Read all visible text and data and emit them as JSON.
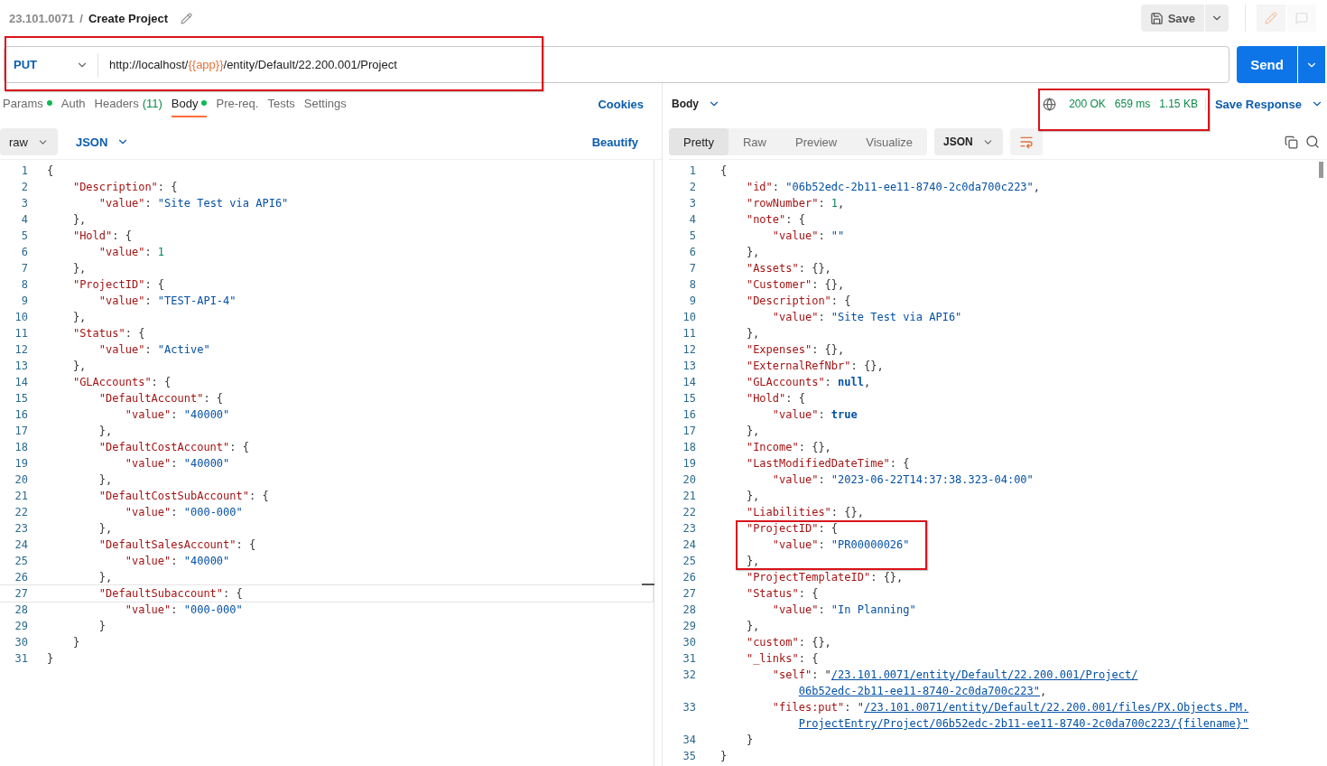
{
  "breadcrumb": {
    "collection": "23.101.0071",
    "separator": "/",
    "title": "Create Project"
  },
  "header_actions": {
    "save": "Save"
  },
  "request": {
    "method": "PUT",
    "url_parts": [
      {
        "kind": "plain",
        "text": "http://localhost/"
      },
      {
        "kind": "variable",
        "text": "{{app}}"
      },
      {
        "kind": "plain",
        "text": "/entity/Default/22.200.001/Project"
      }
    ],
    "send": "Send"
  },
  "request_tabs": [
    {
      "label": "Params",
      "indicator": true,
      "selected": false
    },
    {
      "label": "Auth",
      "indicator": false,
      "selected": false
    },
    {
      "label": "Headers",
      "count": "(11)",
      "indicator": false,
      "selected": false
    },
    {
      "label": "Body",
      "indicator": true,
      "selected": true
    },
    {
      "label": "Pre-req.",
      "indicator": false,
      "selected": false
    },
    {
      "label": "Tests",
      "indicator": false,
      "selected": false
    },
    {
      "label": "Settings",
      "indicator": false,
      "selected": false
    }
  ],
  "cookies": "Cookies",
  "body_options": {
    "mode": "raw",
    "language": "JSON",
    "beautify": "Beautify"
  },
  "request_body": [
    {
      "number": "1",
      "text": "{",
      "active": false
    },
    {
      "number": "2",
      "text": "    \"Description\": {",
      "active": false
    },
    {
      "number": "3",
      "text": "        \"value\": \"Site Test via API6\"",
      "active": false
    },
    {
      "number": "4",
      "text": "    },",
      "active": false
    },
    {
      "number": "5",
      "text": "    \"Hold\": {",
      "active": false
    },
    {
      "number": "6",
      "text": "        \"value\": 1",
      "active": false
    },
    {
      "number": "7",
      "text": "    },",
      "active": false
    },
    {
      "number": "8",
      "text": "    \"ProjectID\": {",
      "active": false
    },
    {
      "number": "9",
      "text": "        \"value\": \"TEST-API-4\"",
      "active": false
    },
    {
      "number": "10",
      "text": "    },",
      "active": false
    },
    {
      "number": "11",
      "text": "    \"Status\": {",
      "active": false
    },
    {
      "number": "12",
      "text": "        \"value\": \"Active\"",
      "active": false
    },
    {
      "number": "13",
      "text": "    },",
      "active": false
    },
    {
      "number": "14",
      "text": "    \"GLAccounts\": {",
      "active": false
    },
    {
      "number": "15",
      "text": "        \"DefaultAccount\": {",
      "active": false
    },
    {
      "number": "16",
      "text": "            \"value\": \"40000\"",
      "active": false
    },
    {
      "number": "17",
      "text": "        },",
      "active": false
    },
    {
      "number": "18",
      "text": "        \"DefaultCostAccount\": {",
      "active": false
    },
    {
      "number": "19",
      "text": "            \"value\": \"40000\"",
      "active": false
    },
    {
      "number": "20",
      "text": "        },",
      "active": false
    },
    {
      "number": "21",
      "text": "        \"DefaultCostSubAccount\": {",
      "active": false
    },
    {
      "number": "22",
      "text": "            \"value\": \"000-000\"",
      "active": false
    },
    {
      "number": "23",
      "text": "        },",
      "active": false
    },
    {
      "number": "24",
      "text": "        \"DefaultSalesAccount\": {",
      "active": false
    },
    {
      "number": "25",
      "text": "            \"value\": \"40000\"",
      "active": false
    },
    {
      "number": "26",
      "text": "        },",
      "active": false
    },
    {
      "number": "27",
      "text": "        \"DefaultSubaccount\": {",
      "active": true
    },
    {
      "number": "28",
      "text": "            \"value\": \"000-000\"",
      "active": false
    },
    {
      "number": "29",
      "text": "        }",
      "active": false
    },
    {
      "number": "30",
      "text": "    }",
      "active": false
    },
    {
      "number": "31",
      "text": "}",
      "active": false
    }
  ],
  "response_toolbar": {
    "section": "Body",
    "status": "200 OK",
    "time": "659 ms",
    "size": "1.15 KB",
    "save_response": "Save Response"
  },
  "response_views": [
    {
      "label": "Pretty",
      "selected": true
    },
    {
      "label": "Raw",
      "selected": false
    },
    {
      "label": "Preview",
      "selected": false
    },
    {
      "label": "Visualize",
      "selected": false
    }
  ],
  "response_format": "JSON",
  "response_body": [
    {
      "number": "1",
      "text": "{"
    },
    {
      "number": "2",
      "text": "    \"id\": \"06b52edc-2b11-ee11-8740-2c0da700c223\","
    },
    {
      "number": "3",
      "text": "    \"rowNumber\": 1,"
    },
    {
      "number": "4",
      "text": "    \"note\": {"
    },
    {
      "number": "5",
      "text": "        \"value\": \"\""
    },
    {
      "number": "6",
      "text": "    },"
    },
    {
      "number": "7",
      "text": "    \"Assets\": {},"
    },
    {
      "number": "8",
      "text": "    \"Customer\": {},"
    },
    {
      "number": "9",
      "text": "    \"Description\": {"
    },
    {
      "number": "10",
      "text": "        \"value\": \"Site Test via API6\""
    },
    {
      "number": "11",
      "text": "    },"
    },
    {
      "number": "12",
      "text": "    \"Expenses\": {},"
    },
    {
      "number": "13",
      "text": "    \"ExternalRefNbr\": {},"
    },
    {
      "number": "14",
      "text": "    \"GLAccounts\": null,"
    },
    {
      "number": "15",
      "text": "    \"Hold\": {"
    },
    {
      "number": "16",
      "text": "        \"value\": true"
    },
    {
      "number": "17",
      "text": "    },"
    },
    {
      "number": "18",
      "text": "    \"Income\": {},"
    },
    {
      "number": "19",
      "text": "    \"LastModifiedDateTime\": {"
    },
    {
      "number": "20",
      "text": "        \"value\": \"2023-06-22T14:37:38.323-04:00\""
    },
    {
      "number": "21",
      "text": "    },"
    },
    {
      "number": "22",
      "text": "    \"Liabilities\": {},"
    },
    {
      "number": "23",
      "text": "    \"ProjectID\": {"
    },
    {
      "number": "24",
      "text": "        \"value\": \"PR00000026\""
    },
    {
      "number": "25",
      "text": "    },"
    },
    {
      "number": "26",
      "text": "    \"ProjectTemplateID\": {},"
    },
    {
      "number": "27",
      "text": "    \"Status\": {"
    },
    {
      "number": "28",
      "text": "        \"value\": \"In Planning\""
    },
    {
      "number": "29",
      "text": "    },"
    },
    {
      "number": "30",
      "text": "    \"custom\": {},"
    },
    {
      "number": "31",
      "text": "    \"_links\": {"
    },
    {
      "number": "32",
      "text": "        \"self\": \"",
      "link": [
        "/23.101.0071/entity/Default/22.200.001/Project/",
        "06b52edc-2b11-ee11-8740-2c0da700c223\""
      ],
      "after": ","
    },
    {
      "number": "33",
      "text": "        \"files:put\": \"",
      "link": [
        "/23.101.0071/entity/Default/22.200.001/files/PX.Objects.PM.",
        "ProjectEntry/Project/06b52edc-2b11-ee11-8740-2c0da700c223/{filename}\""
      ]
    },
    {
      "number": "34",
      "text": "    }"
    },
    {
      "number": "35",
      "text": "}"
    }
  ]
}
